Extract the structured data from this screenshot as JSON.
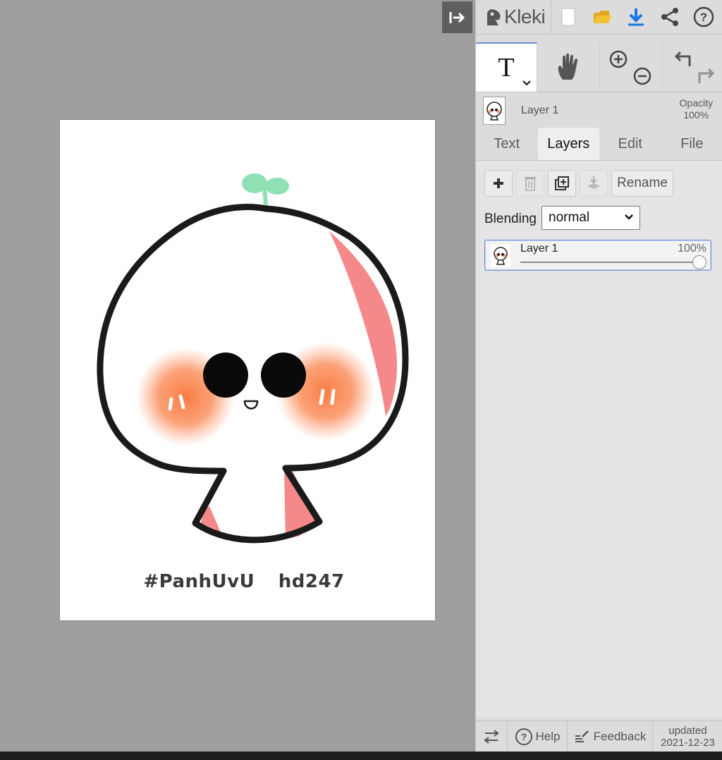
{
  "app": {
    "logo_text": "Kleki"
  },
  "canvas": {
    "signature_left": "#PanhUvU",
    "signature_right": "hd247"
  },
  "tools": {
    "text_tool_glyph": "T"
  },
  "layer_preview": {
    "name": "Layer 1",
    "opacity_label": "Opacity",
    "opacity_value": "100%"
  },
  "tabs": [
    {
      "label": "Text"
    },
    {
      "label": "Layers"
    },
    {
      "label": "Edit"
    },
    {
      "label": "File"
    }
  ],
  "layers_panel": {
    "rename_label": "Rename",
    "blending_label": "Blending",
    "blending_value": "normal",
    "layers": [
      {
        "name": "Layer 1",
        "opacity_text": "100%",
        "opacity": 1.0
      }
    ]
  },
  "footer": {
    "help_label": "Help",
    "feedback_label": "Feedback",
    "updated_label": "updated",
    "updated_date": "2021-12-23"
  },
  "colors": {
    "accent": "#6a8fd4",
    "download_icon": "#1a73e8",
    "folder_icon": "#f2c230"
  },
  "icons": [
    "collapse-icon",
    "kleki-logo-icon",
    "new-image-icon",
    "open-folder-icon",
    "download-icon",
    "share-icon",
    "help-icon",
    "hand-icon",
    "zoom-in-icon",
    "zoom-out-icon",
    "undo-icon",
    "redo-icon",
    "add-layer-icon",
    "delete-layer-icon",
    "duplicate-layer-icon",
    "merge-layer-icon",
    "swap-side-icon",
    "feedback-icon"
  ]
}
